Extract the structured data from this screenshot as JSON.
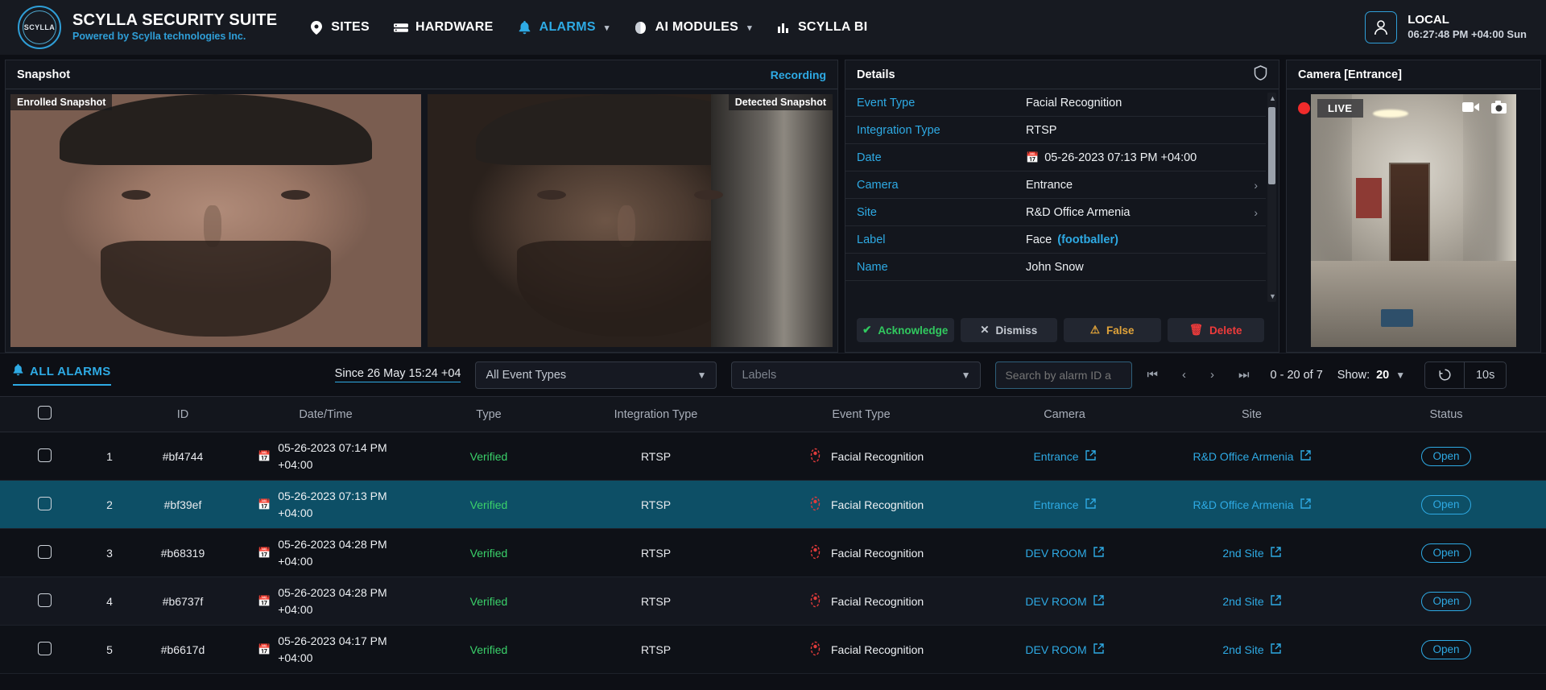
{
  "header": {
    "logo_text": "SCYLLA",
    "brand_title": "SCYLLA SECURITY SUITE",
    "brand_subtitle": "Powered by Scylla technologies Inc.",
    "nav": [
      {
        "label": "SITES",
        "icon": "location-pin-icon",
        "active": false,
        "caret": false
      },
      {
        "label": "HARDWARE",
        "icon": "server-icon",
        "active": false,
        "caret": false
      },
      {
        "label": "ALARMS",
        "icon": "bell-icon",
        "active": true,
        "caret": true
      },
      {
        "label": "AI MODULES",
        "icon": "brain-icon",
        "active": false,
        "caret": true
      },
      {
        "label": "SCYLLA BI",
        "icon": "bar-chart-icon",
        "active": false,
        "caret": false
      }
    ],
    "user": {
      "name": "LOCAL",
      "time": "06:27:48 PM +04:00 Sun"
    }
  },
  "snapshot_panel": {
    "title": "Snapshot",
    "recording_link": "Recording",
    "enrolled_label": "Enrolled Snapshot",
    "detected_label": "Detected Snapshot"
  },
  "details_panel": {
    "title": "Details",
    "shield_icon": "shield-icon",
    "rows": [
      {
        "key": "Event Type",
        "value": "Facial Recognition"
      },
      {
        "key": "Integration Type",
        "value": "RTSP"
      },
      {
        "key": "Date",
        "value": "05-26-2023 07:13 PM +04:00",
        "icon": "calendar-icon"
      },
      {
        "key": "Camera",
        "value": "Entrance",
        "chevron": true
      },
      {
        "key": "Site",
        "value": "R&D Office Armenia",
        "chevron": true
      },
      {
        "key": "Label",
        "value": "Face",
        "extra": "(footballer)"
      },
      {
        "key": "Name",
        "value": "John Snow"
      }
    ],
    "actions": [
      {
        "label": "Acknowledge",
        "icon": "check-icon",
        "style": "ack"
      },
      {
        "label": "Dismiss",
        "icon": "close-icon",
        "style": "dis"
      },
      {
        "label": "False",
        "icon": "warning-triangle-icon",
        "style": "false"
      },
      {
        "label": "Delete",
        "icon": "trash-icon",
        "style": "del"
      }
    ]
  },
  "camera_panel": {
    "title": "Camera [Entrance]",
    "live_label": "LIVE",
    "record_icon": "video-record-icon",
    "snapshot_icon": "camera-icon"
  },
  "alarms_toolbar": {
    "all_alarms_label": "ALL ALARMS",
    "bell_icon": "bell-icon",
    "since_label": "Since 26 May 15:24 +04",
    "event_types_value": "All Event Types",
    "labels_placeholder": "Labels",
    "search_placeholder": "Search by alarm ID a",
    "page_info": "0 - 20 of 7",
    "show_label": "Show:",
    "show_value": "20",
    "refresh_icon": "refresh-icon",
    "refresh_interval": "10s",
    "pager_icons": [
      "first-page-icon",
      "prev-page-icon",
      "next-page-icon",
      "last-page-icon"
    ]
  },
  "table": {
    "columns": [
      "",
      "",
      "ID",
      "Date/Time",
      "Type",
      "Integration Type",
      "Event Type",
      "Camera",
      "Site",
      "Status"
    ],
    "rows": [
      {
        "num": "1",
        "id": "#bf4744",
        "date": "05-26-2023 07:14 PM",
        "tz": "+04:00",
        "type": "Verified",
        "integration": "RTSP",
        "event": "Facial Recognition",
        "camera": "Entrance",
        "site": "R&D Office Armenia",
        "status": "Open",
        "selected": false
      },
      {
        "num": "2",
        "id": "#bf39ef",
        "date": "05-26-2023 07:13 PM",
        "tz": "+04:00",
        "type": "Verified",
        "integration": "RTSP",
        "event": "Facial Recognition",
        "camera": "Entrance",
        "site": "R&D Office Armenia",
        "status": "Open",
        "selected": true
      },
      {
        "num": "3",
        "id": "#b68319",
        "date": "05-26-2023 04:28 PM",
        "tz": "+04:00",
        "type": "Verified",
        "integration": "RTSP",
        "event": "Facial Recognition",
        "camera": "DEV ROOM",
        "site": "2nd Site",
        "status": "Open",
        "selected": false
      },
      {
        "num": "4",
        "id": "#b6737f",
        "date": "05-26-2023 04:28 PM",
        "tz": "+04:00",
        "type": "Verified",
        "integration": "RTSP",
        "event": "Facial Recognition",
        "camera": "DEV ROOM",
        "site": "2nd Site",
        "status": "Open",
        "selected": false
      },
      {
        "num": "5",
        "id": "#b6617d",
        "date": "05-26-2023 04:17 PM",
        "tz": "+04:00",
        "type": "Verified",
        "integration": "RTSP",
        "event": "Facial Recognition",
        "camera": "DEV ROOM",
        "site": "2nd Site",
        "status": "Open",
        "selected": false
      }
    ]
  },
  "colors": {
    "accent": "#2eaae4",
    "success": "#31c95f",
    "warning": "#e0a33a",
    "danger": "#ef3b3b",
    "selected_row": "#0d4f66"
  }
}
